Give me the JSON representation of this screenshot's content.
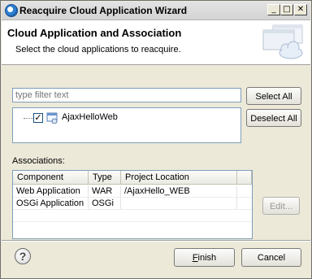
{
  "window": {
    "title": "Reacquire Cloud Application Wizard",
    "controls": {
      "minimize": "_",
      "maximize": "□",
      "close": "✕"
    }
  },
  "header": {
    "title": "Cloud Application and Association",
    "description": "Select the cloud applications to reacquire."
  },
  "filter": {
    "placeholder": "type filter text",
    "value": ""
  },
  "buttons": {
    "select_all": "Select All",
    "deselect_all": "Deselect All",
    "edit": "Edit...",
    "finish": "Finish",
    "cancel": "Cancel"
  },
  "tree": {
    "items": [
      {
        "label": "AjaxHelloWeb",
        "checked": true
      }
    ]
  },
  "associations": {
    "label": "Associations:",
    "columns": [
      "Component",
      "Type",
      "Project Location"
    ],
    "rows": [
      [
        "Web Application",
        "WAR",
        "/AjaxHello_WEB"
      ],
      [
        "OSGi Application",
        "OSGi",
        ""
      ]
    ]
  },
  "colors": {
    "dialog_background": "#ece9d8",
    "header_background": "#ffffff",
    "input_border": "#7f9db9"
  },
  "icons": {
    "title": "eclipse-icon",
    "help": "help-icon",
    "tree_item": "cloud-app-icon",
    "banner": "cloud-wizard-banner-icon"
  }
}
